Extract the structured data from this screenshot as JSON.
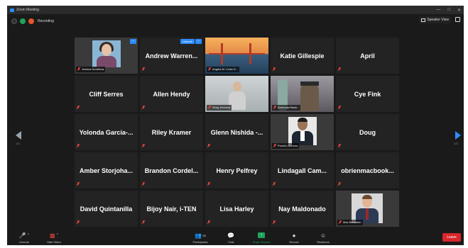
{
  "window": {
    "title": "Zoom Meeting"
  },
  "topbar": {
    "recording_label": "Recording",
    "speaker_view_label": "Speaker View"
  },
  "pagination": {
    "left": "1/3",
    "right": "1/3"
  },
  "tiles": [
    {
      "name": "",
      "label": "Jessica Nordlinsa",
      "type": "portrait",
      "more": true,
      "unmute": false
    },
    {
      "name": "Andrew  Warren...",
      "label": "",
      "type": "name",
      "more": true,
      "unmute": true
    },
    {
      "name": "",
      "label": "Angela M. Crain D...",
      "type": "bridge",
      "more": false,
      "unmute": false
    },
    {
      "name": "Katie Gillespie",
      "label": "",
      "type": "name",
      "more": false,
      "unmute": false
    },
    {
      "name": "April",
      "label": "",
      "type": "name",
      "more": false,
      "unmute": false
    },
    {
      "name": "Cliff Serres",
      "label": "",
      "type": "name",
      "more": false,
      "unmute": false
    },
    {
      "name": "Allen Hendy",
      "label": "",
      "type": "name",
      "more": false,
      "unmute": false
    },
    {
      "name": "",
      "label": "Greg Johnson",
      "type": "office",
      "more": false,
      "unmute": false,
      "active": true
    },
    {
      "name": "",
      "label": "American Bank...",
      "type": "statue",
      "more": false,
      "unmute": false
    },
    {
      "name": "Cye Fink",
      "label": "",
      "type": "name",
      "more": false,
      "unmute": false
    },
    {
      "name": "Yolonda  Garcia-...",
      "label": "",
      "type": "name",
      "more": false,
      "unmute": false
    },
    {
      "name": "Riley Kramer",
      "label": "",
      "type": "name",
      "more": false,
      "unmute": false
    },
    {
      "name": "Glenn  Nishida  -...",
      "label": "",
      "type": "name",
      "more": false,
      "unmute": false
    },
    {
      "name": "",
      "label": "Poncho Moreno",
      "type": "suit",
      "more": false,
      "unmute": false
    },
    {
      "name": "Doug",
      "label": "",
      "type": "name",
      "more": false,
      "unmute": false
    },
    {
      "name": "Amber  Storjoha...",
      "label": "",
      "type": "name",
      "more": false,
      "unmute": false
    },
    {
      "name": "Brandon  Cordel...",
      "label": "",
      "type": "name",
      "more": false,
      "unmute": false
    },
    {
      "name": "Henry Pelfrey",
      "label": "",
      "type": "name",
      "more": false,
      "unmute": false
    },
    {
      "name": "Lindagall  Cam...",
      "label": "",
      "type": "name",
      "more": false,
      "unmute": false
    },
    {
      "name": "obrienmacbook...",
      "label": "",
      "type": "name",
      "more": false,
      "unmute": false
    },
    {
      "name": "David Quintanilla",
      "label": "",
      "type": "name",
      "more": false,
      "unmute": false
    },
    {
      "name": "Bijoy Nair, i-TEN",
      "label": "",
      "type": "name",
      "more": false,
      "unmute": false
    },
    {
      "name": "Lisa Harley",
      "label": "",
      "type": "name",
      "more": false,
      "unmute": false
    },
    {
      "name": "Nay Maldonado",
      "label": "",
      "type": "name",
      "more": false,
      "unmute": false
    },
    {
      "name": "",
      "label": "Max Bernstein",
      "type": "portrait2",
      "more": false,
      "unmute": false
    }
  ],
  "tile_buttons": {
    "unmute": "Unmute",
    "more": "..."
  },
  "toolbar": {
    "unmute": "Unmute",
    "start_video": "Start Video",
    "participants": "Participants",
    "participants_count": "35",
    "chat": "Chat",
    "share_screen": "Share Screen",
    "record": "Record",
    "reactions": "Reactions",
    "leave": "Leave"
  }
}
